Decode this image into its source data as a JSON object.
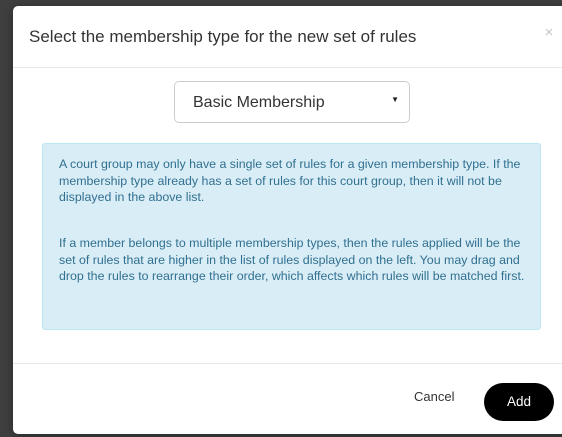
{
  "dialog": {
    "title": "Select the membership type for the new set of rules",
    "close_label": "×"
  },
  "membership_select": {
    "selected_value": "Basic Membership",
    "caret_icon": "caret-down-icon"
  },
  "info": {
    "paragraph_1": "A court group may only have a single set of rules for a given membership type. If the membership type already has a set of rules for this court group, then it will not be displayed in the above list.",
    "paragraph_2": "If a member belongs to multiple membership types, then the rules applied will be the set of rules that are higher in the list of rules displayed on the left. You may drag and drop the rules to rearrange their order, which affects which rules will be matched first."
  },
  "footer": {
    "cancel_label": "Cancel",
    "add_label": "Add"
  },
  "colors": {
    "info_background": "#d9edf7",
    "info_text": "#31708f",
    "primary_button": "#000000"
  }
}
